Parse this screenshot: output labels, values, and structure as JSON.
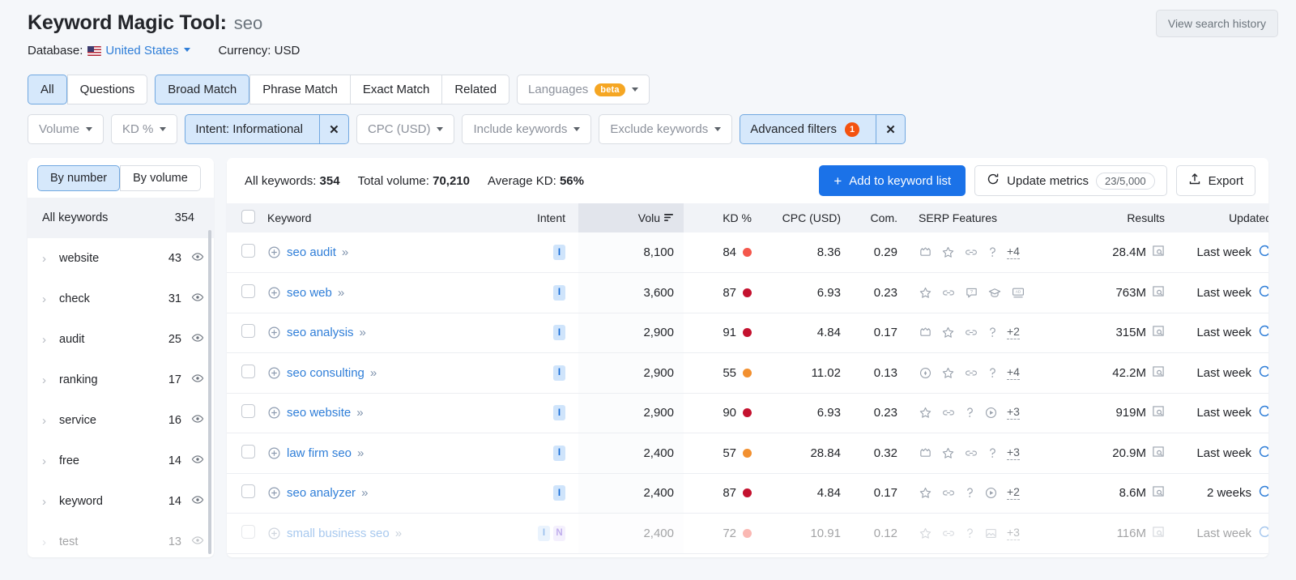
{
  "header": {
    "title_main": "Keyword Magic Tool:",
    "title_query": "seo",
    "database_label": "Database:",
    "database_value": "United States",
    "currency": "Currency: USD",
    "view_history": "View search history",
    "flag_icon": "us-flag-icon"
  },
  "filters": {
    "match_group_1": [
      {
        "label": "All",
        "active": true
      },
      {
        "label": "Questions",
        "active": false
      }
    ],
    "match_group_2": [
      {
        "label": "Broad Match",
        "active": true
      },
      {
        "label": "Phrase Match",
        "active": false
      },
      {
        "label": "Exact Match",
        "active": false
      },
      {
        "label": "Related",
        "active": false
      }
    ],
    "languages": {
      "label": "Languages",
      "badge": "beta"
    },
    "row2": [
      {
        "label": "Volume",
        "type": "dropdown"
      },
      {
        "label": "KD %",
        "type": "dropdown"
      },
      {
        "label": "Intent: Informational",
        "type": "applied",
        "close": "✕"
      },
      {
        "label": "CPC (USD)",
        "type": "dropdown"
      },
      {
        "label": "Include keywords",
        "type": "dropdown"
      },
      {
        "label": "Exclude keywords",
        "type": "dropdown"
      },
      {
        "label": "Advanced filters",
        "type": "applied-count",
        "count": "1",
        "close": "✕"
      }
    ]
  },
  "sidebar": {
    "toggle": [
      {
        "label": "By number",
        "active": true
      },
      {
        "label": "By volume",
        "active": false
      }
    ],
    "all_keywords": {
      "label": "All keywords",
      "count": "354"
    },
    "groups": [
      {
        "label": "website",
        "count": "43"
      },
      {
        "label": "check",
        "count": "31"
      },
      {
        "label": "audit",
        "count": "25"
      },
      {
        "label": "ranking",
        "count": "17"
      },
      {
        "label": "service",
        "count": "16"
      },
      {
        "label": "free",
        "count": "14"
      },
      {
        "label": "keyword",
        "count": "14"
      },
      {
        "label": "test",
        "count": "13"
      }
    ]
  },
  "toolbar": {
    "all_keywords_label": "All keywords:",
    "all_keywords_value": "354",
    "total_volume_label": "Total volume:",
    "total_volume_value": "70,210",
    "average_kd_label": "Average KD:",
    "average_kd_value": "56%",
    "add_to_list": "Add to keyword list",
    "update_metrics": "Update metrics",
    "quota": "23/5,000",
    "export": "Export"
  },
  "table": {
    "columns": [
      {
        "key": "checkbox",
        "label": ""
      },
      {
        "key": "keyword",
        "label": "Keyword"
      },
      {
        "key": "intent",
        "label": "Intent"
      },
      {
        "key": "volume",
        "label": "Volu",
        "sorted": true
      },
      {
        "key": "kd",
        "label": "KD %"
      },
      {
        "key": "cpc",
        "label": "CPC (USD)"
      },
      {
        "key": "com",
        "label": "Com."
      },
      {
        "key": "serp",
        "label": "SERP Features"
      },
      {
        "key": "results",
        "label": "Results"
      },
      {
        "key": "updated",
        "label": "Updated"
      }
    ],
    "rows": [
      {
        "keyword": "seo audit",
        "intent": [
          "I"
        ],
        "volume": "8,100",
        "kd": "84",
        "kd_color": "#f4574c",
        "cpc": "8.36",
        "com": "0.29",
        "serp": [
          "featured-snippet-icon",
          "reviews-icon",
          "sitelinks-icon",
          "faq-icon"
        ],
        "serp_more": "+4",
        "results": "28.4M",
        "updated": "Last week",
        "faded": false
      },
      {
        "keyword": "seo web",
        "intent": [
          "I"
        ],
        "volume": "3,600",
        "kd": "87",
        "kd_color": "#c4122f",
        "cpc": "6.93",
        "com": "0.23",
        "serp": [
          "reviews-icon",
          "sitelinks-icon",
          "questions-icon",
          "knowledge-panel-icon",
          "ads-top-icon"
        ],
        "serp_more": "",
        "results": "763M",
        "updated": "Last week",
        "faded": false
      },
      {
        "keyword": "seo analysis",
        "intent": [
          "I"
        ],
        "volume": "2,900",
        "kd": "91",
        "kd_color": "#c4122f",
        "cpc": "4.84",
        "com": "0.17",
        "serp": [
          "featured-snippet-icon",
          "reviews-icon",
          "sitelinks-icon",
          "faq-icon"
        ],
        "serp_more": "+2",
        "results": "315M",
        "updated": "Last week",
        "faded": false
      },
      {
        "keyword": "seo consulting",
        "intent": [
          "I"
        ],
        "volume": "2,900",
        "kd": "55",
        "kd_color": "#f29030",
        "cpc": "11.02",
        "com": "0.13",
        "serp": [
          "local-pack-icon",
          "reviews-icon",
          "sitelinks-icon",
          "faq-icon"
        ],
        "serp_more": "+4",
        "results": "42.2M",
        "updated": "Last week",
        "faded": false
      },
      {
        "keyword": "seo website",
        "intent": [
          "I"
        ],
        "volume": "2,900",
        "kd": "90",
        "kd_color": "#c4122f",
        "cpc": "6.93",
        "com": "0.23",
        "serp": [
          "reviews-icon",
          "sitelinks-icon",
          "faq-icon",
          "video-icon"
        ],
        "serp_more": "+3",
        "results": "919M",
        "updated": "Last week",
        "faded": false
      },
      {
        "keyword": "law firm seo",
        "intent": [
          "I"
        ],
        "volume": "2,400",
        "kd": "57",
        "kd_color": "#f29030",
        "cpc": "28.84",
        "com": "0.32",
        "serp": [
          "featured-snippet-icon",
          "reviews-icon",
          "sitelinks-icon",
          "faq-icon"
        ],
        "serp_more": "+3",
        "results": "20.9M",
        "updated": "Last week",
        "faded": false
      },
      {
        "keyword": "seo analyzer",
        "intent": [
          "I"
        ],
        "volume": "2,400",
        "kd": "87",
        "kd_color": "#c4122f",
        "cpc": "4.84",
        "com": "0.17",
        "serp": [
          "reviews-icon",
          "sitelinks-icon",
          "faq-icon",
          "video-icon"
        ],
        "serp_more": "+2",
        "results": "8.6M",
        "updated": "2 weeks",
        "faded": false
      },
      {
        "keyword": "small business seo",
        "intent": [
          "I",
          "N"
        ],
        "volume": "2,400",
        "kd": "72",
        "kd_color": "#f4574c",
        "cpc": "10.91",
        "com": "0.12",
        "serp": [
          "reviews-icon",
          "sitelinks-icon",
          "faq-icon",
          "image-pack-icon"
        ],
        "serp_more": "+3",
        "results": "116M",
        "updated": "Last week",
        "faded": true
      }
    ]
  },
  "colors": {
    "accent_blue": "#1b72e8",
    "link_blue": "#2f7ed8",
    "selected_fill": "#d6e8fb",
    "selected_border": "#71a8e0",
    "badge_orange": "#f4520f",
    "beta_orange": "#f5a623"
  }
}
